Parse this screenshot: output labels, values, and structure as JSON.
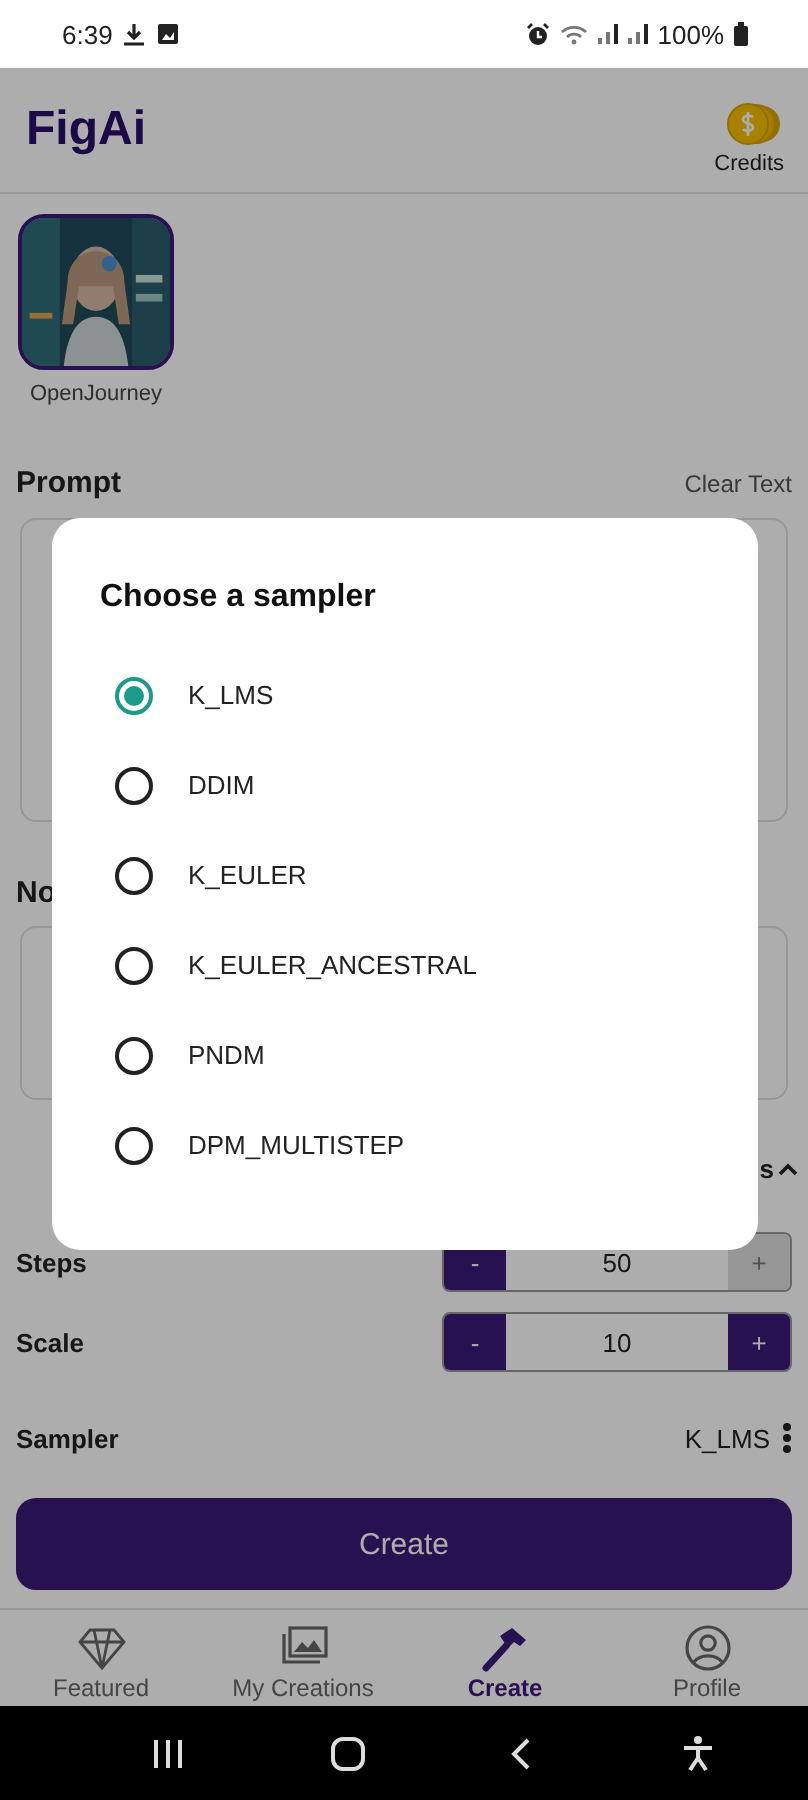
{
  "status_bar": {
    "time": "6:39",
    "battery": "100%"
  },
  "app_bar": {
    "title": "FigAi",
    "credits_label": "Credits"
  },
  "models": [
    {
      "name": "OpenJourney",
      "selected": true
    }
  ],
  "prompt": {
    "label": "Prompt",
    "clear_action": "Clear Text"
  },
  "negative_prompt": {
    "label": "No"
  },
  "settings": {
    "label": "s",
    "expanded": true
  },
  "steppers": [
    {
      "label": "Steps",
      "minus": "-",
      "value": "50",
      "plus": "+",
      "plus_disabled": true
    },
    {
      "label": "Scale",
      "minus": "-",
      "value": "10",
      "plus": "+",
      "plus_disabled": false
    }
  ],
  "sampler": {
    "label": "Sampler",
    "value": "K_LMS"
  },
  "create_button": "Create",
  "bottom_nav": [
    {
      "label": "Featured",
      "kind": "diamond",
      "selected": false
    },
    {
      "label": "My Creations",
      "kind": "gallery",
      "selected": false
    },
    {
      "label": "Create",
      "kind": "hammer",
      "selected": true
    },
    {
      "label": "Profile",
      "kind": "profile",
      "selected": false
    }
  ],
  "dialog": {
    "title": "Choose a sampler",
    "options": [
      {
        "label": "K_LMS",
        "selected": true
      },
      {
        "label": "DDIM",
        "selected": false
      },
      {
        "label": "K_EULER",
        "selected": false
      },
      {
        "label": "K_EULER_ANCESTRAL",
        "selected": false
      },
      {
        "label": "PNDM",
        "selected": false
      },
      {
        "label": "DPM_MULTISTEP",
        "selected": false
      }
    ]
  }
}
